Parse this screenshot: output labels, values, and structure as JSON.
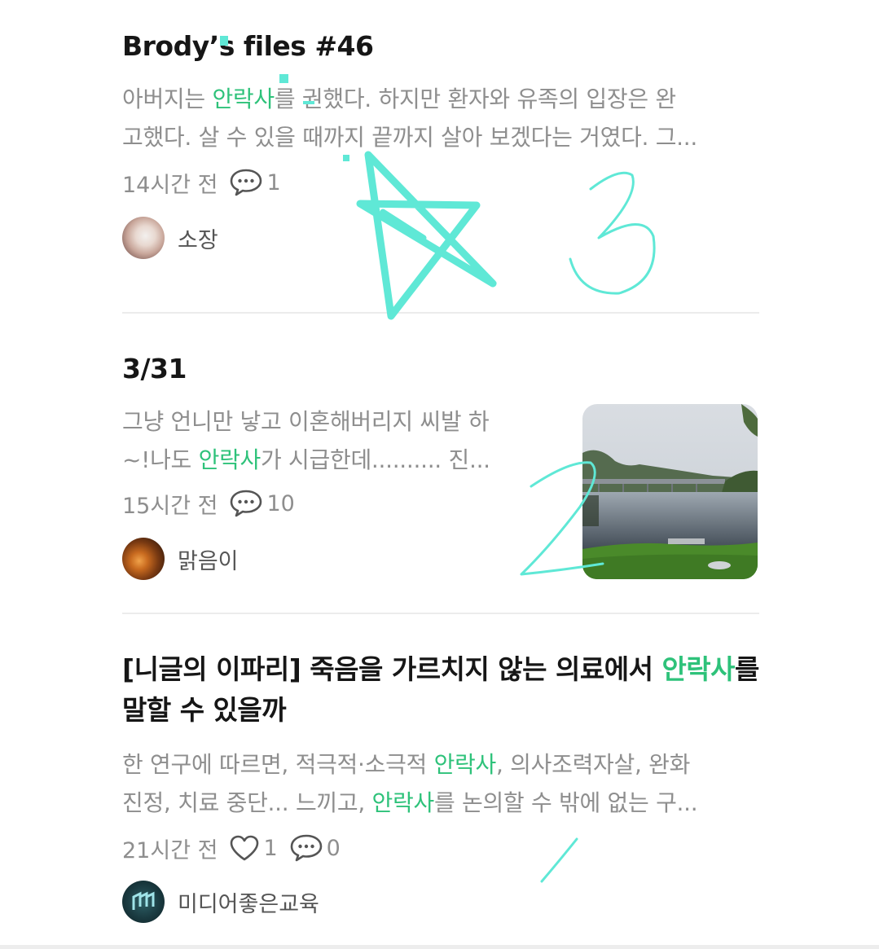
{
  "posts": [
    {
      "title": "Brody’s files #46",
      "excerpt_line1": [
        {
          "text": "아버지는 ",
          "hl": false
        },
        {
          "text": "안락사",
          "hl": true
        },
        {
          "text": "를 권했다. 하지만 환자와 유족의 입장은 완",
          "hl": false
        }
      ],
      "excerpt_line2": "고했다. 살 수 있을 때까지 끝까지 살아 보겠다는 거였다. 그...",
      "time": "14시간 전",
      "comments": "1",
      "author": "소장"
    },
    {
      "title": "3/31",
      "excerpt_line1": "그냥 언니만 낳고 이혼해버리지 씨발 하",
      "excerpt_line2": [
        {
          "text": "~!나도 ",
          "hl": false
        },
        {
          "text": "안락사",
          "hl": true
        },
        {
          "text": "가 시급한데.......... 진...",
          "hl": false
        }
      ],
      "time": "15시간 전",
      "comments": "10",
      "author": "맑음이"
    },
    {
      "title": [
        {
          "text": "[니글의 이파리] 죽음을 가르치지 않는 의료에서 ",
          "hl": false
        },
        {
          "text": "안락사",
          "hl": true
        },
        {
          "text": "를 말할 수 있을까",
          "hl": false
        }
      ],
      "excerpt_line1": [
        {
          "text": "한 연구에 따르면, 적극적·소극적 ",
          "hl": false
        },
        {
          "text": "안락사",
          "hl": true
        },
        {
          "text": ", 의사조력자살, 완화",
          "hl": false
        }
      ],
      "excerpt_line2": [
        {
          "text": "진정, 치료 중단... 느끼고, ",
          "hl": false
        },
        {
          "text": "안락사",
          "hl": true
        },
        {
          "text": "를 논의할 수 밖에 없는 구...",
          "hl": false
        }
      ],
      "time": "21시간 전",
      "likes": "1",
      "comments": "0",
      "author": "미디어좋은교육"
    }
  ],
  "annotations": [
    "3",
    "2",
    "1"
  ],
  "colors": {
    "highlight": "#2ec27a",
    "annotation": "#5fe8d6"
  }
}
